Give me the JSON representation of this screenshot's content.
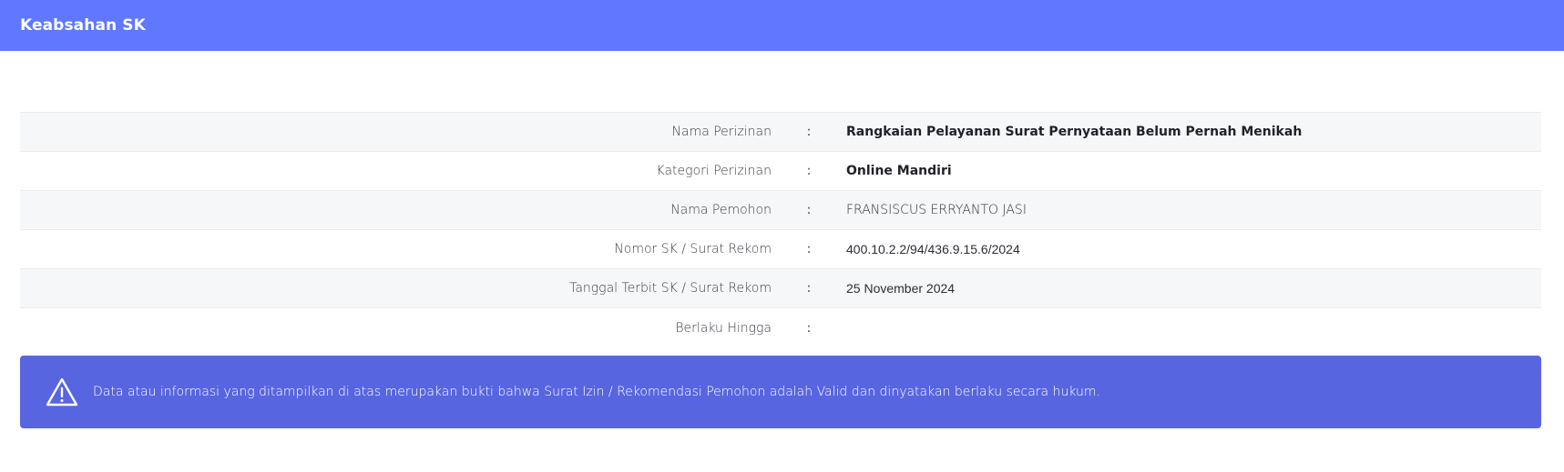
{
  "header": {
    "title": "Keabsahan SK"
  },
  "details": [
    {
      "label": "Nama Perizinan",
      "separator": ":",
      "value": "Rangkaian Pelayanan Surat Pernyataan Belum Pernah Menikah"
    },
    {
      "label": "Kategori Perizinan",
      "separator": ":",
      "value": "Online Mandiri"
    },
    {
      "label": "Nama Pemohon",
      "separator": ":",
      "value": "FRANSISCUS ERRYANTO JASI"
    },
    {
      "label": "Nomor SK / Surat Rekom",
      "separator": ":",
      "value": "400.10.2.2/94/436.9.15.6/2024"
    },
    {
      "label": "Tanggal Terbit SK / Surat Rekom",
      "separator": ":",
      "value": "25 November 2024"
    },
    {
      "label": "Berlaku Hingga",
      "separator": ":",
      "value": ""
    }
  ],
  "alert": {
    "icon": "warning-triangle-icon",
    "text": "Data atau informasi yang ditampilkan di atas merupakan bukti bahwa Surat Izin / Rekomendasi Pemohon adalah Valid dan dinyatakan berlaku secara hukum."
  },
  "colors": {
    "header_bg": "#5f78ff",
    "alert_bg": "#5865e0",
    "stripe_bg": "#f6f7f9"
  }
}
